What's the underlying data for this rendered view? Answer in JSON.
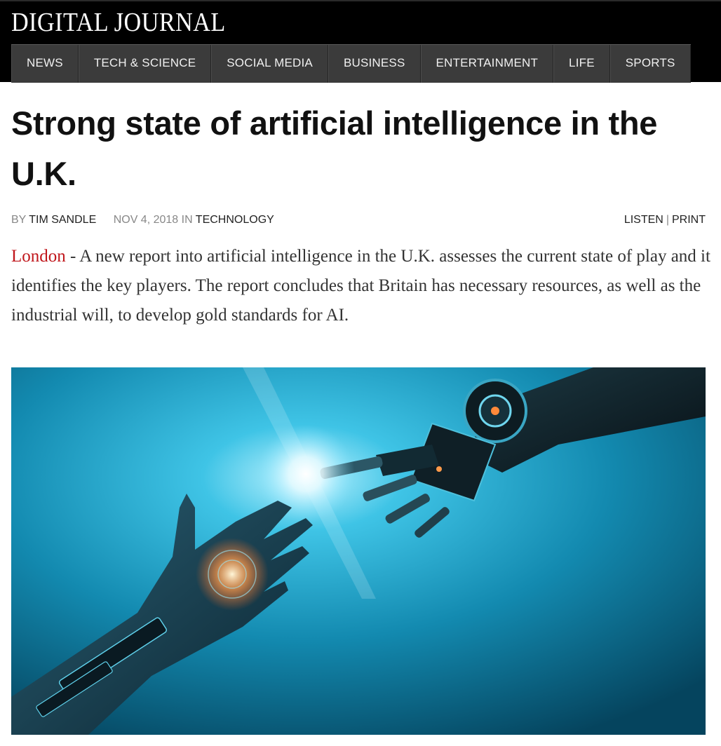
{
  "header": {
    "logo": "DIGITAL JOURNAL",
    "nav": [
      "NEWS",
      "TECH & SCIENCE",
      "SOCIAL MEDIA",
      "BUSINESS",
      "ENTERTAINMENT",
      "LIFE",
      "SPORTS"
    ]
  },
  "article": {
    "headline": "Strong state of artificial intelligence in the U.K.",
    "byline": {
      "by": "BY",
      "author": "TIM SANDLE",
      "date": "NOV 4, 2018",
      "in": "IN",
      "category": "TECHNOLOGY",
      "listen": "LISTEN",
      "separator": "|",
      "print": "PRINT"
    },
    "lede": {
      "location": "London",
      "text": " - A new report into artificial intelligence in the U.K. assesses the current state of play and it identifies the key players. The report concludes that Britain has necessary resources, as well as the industrial will, to develop gold standards for AI."
    },
    "image": {
      "subject": "human hand reaching toward robotic hand with glowing light between fingertips",
      "colors": {
        "background": "#1a8fb5",
        "glow": "#e8fbff"
      }
    }
  }
}
